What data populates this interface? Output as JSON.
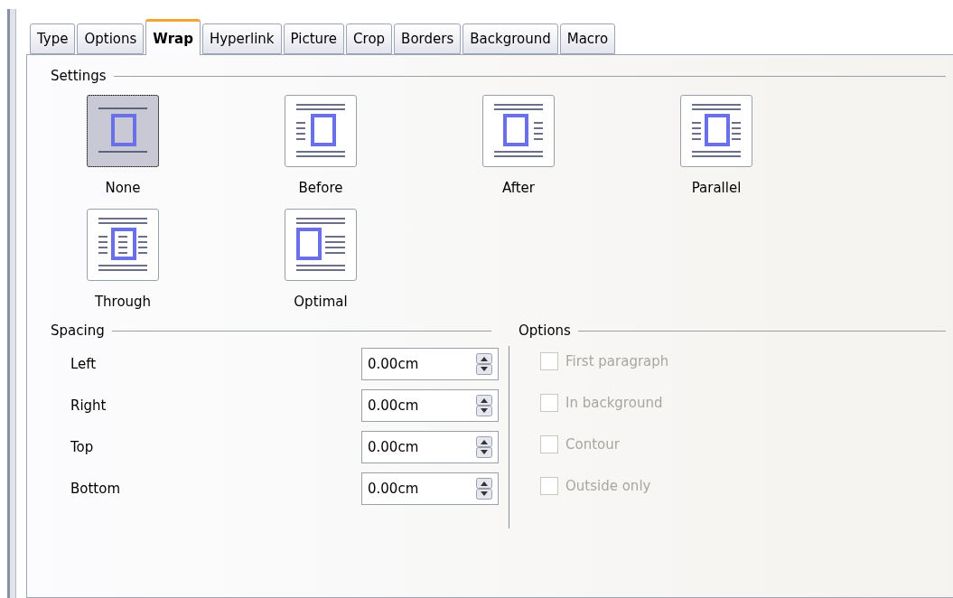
{
  "tabs": [
    {
      "label": "Type",
      "selected": false
    },
    {
      "label": "Options",
      "selected": false
    },
    {
      "label": "Wrap",
      "selected": true
    },
    {
      "label": "Hyperlink",
      "selected": false
    },
    {
      "label": "Picture",
      "selected": false
    },
    {
      "label": "Crop",
      "selected": false
    },
    {
      "label": "Borders",
      "selected": false
    },
    {
      "label": "Background",
      "selected": false
    },
    {
      "label": "Macro",
      "selected": false
    }
  ],
  "settings": {
    "title": "Settings",
    "items": [
      {
        "kind": "none",
        "label": "None",
        "selected": true
      },
      {
        "kind": "before",
        "label": "Before",
        "selected": false
      },
      {
        "kind": "after",
        "label": "After",
        "selected": false
      },
      {
        "kind": "parallel",
        "label": "Parallel",
        "selected": false
      },
      {
        "kind": "through",
        "label": "Through",
        "selected": false
      },
      {
        "kind": "optimal",
        "label": "Optimal",
        "selected": false
      }
    ]
  },
  "spacing": {
    "title": "Spacing",
    "fields": [
      {
        "label": "Left",
        "value": "0.00cm"
      },
      {
        "label": "Right",
        "value": "0.00cm"
      },
      {
        "label": "Top",
        "value": "0.00cm"
      },
      {
        "label": "Bottom",
        "value": "0.00cm"
      }
    ]
  },
  "options": {
    "title": "Options",
    "items": [
      {
        "label": "First paragraph",
        "checked": false,
        "disabled": true
      },
      {
        "label": "In background",
        "checked": false,
        "disabled": true
      },
      {
        "label": "Contour",
        "checked": false,
        "disabled": true
      },
      {
        "label": "Outside only",
        "checked": false,
        "disabled": true
      }
    ]
  }
}
